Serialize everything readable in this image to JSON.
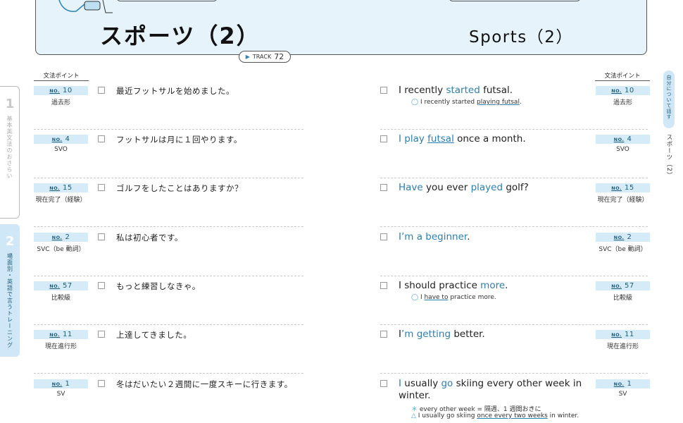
{
  "header": {
    "title_jp": "スポーツ（2）",
    "title_en": "Sports（2）",
    "track_label": "TRACK",
    "track_number": "72"
  },
  "grammar_header": "文法ポイント",
  "left_sidebar": {
    "section1_number": "1",
    "section1_label": "基本英文法のおさらい",
    "section2_number": "2",
    "section2_label": "場面別・英語で言うトレーニング"
  },
  "right_sidebar": {
    "tab_label": "自分について話す",
    "sub_label": "スポーツ（2）"
  },
  "no_label": "NO.",
  "rows": [
    {
      "no": "10",
      "grammar": "過去形",
      "jp": "最近フットサルを始めました。",
      "en": [
        {
          "t": "I recently "
        },
        {
          "t": "started",
          "hl": true
        },
        {
          "t": " futsal."
        }
      ],
      "notes": [
        {
          "mark": "◯",
          "parts": [
            {
              "t": "I recently started "
            },
            {
              "t": "playing futsal",
              "ul": true
            },
            {
              "t": "."
            }
          ]
        }
      ]
    },
    {
      "no": "4",
      "grammar": "SVO",
      "jp": "フットサルは月に１回やります。",
      "en": [
        {
          "t": "I play ",
          "hl": true
        },
        {
          "t": "futsal",
          "hl": true,
          "ul": true
        },
        {
          "t": " once a month."
        }
      ],
      "notes": []
    },
    {
      "no": "15",
      "grammar": "現在完了（経験）",
      "jp": "ゴルフをしたことはありますか？",
      "en": [
        {
          "t": "Have",
          "hl": true
        },
        {
          "t": " you ever "
        },
        {
          "t": "played",
          "hl": true
        },
        {
          "t": " golf?"
        }
      ],
      "notes": []
    },
    {
      "no": "2",
      "grammar": "SVC（be 動詞）",
      "jp": "私は初心者です。",
      "en": [
        {
          "t": "I’m a beginner",
          "hl": true
        },
        {
          "t": "."
        }
      ],
      "notes": []
    },
    {
      "no": "57",
      "grammar": "比較級",
      "jp": "もっと練習しなきゃ。",
      "en": [
        {
          "t": "I should practice "
        },
        {
          "t": "more",
          "hl": true
        },
        {
          "t": "."
        }
      ],
      "notes": [
        {
          "mark": "◯",
          "parts": [
            {
              "t": "I "
            },
            {
              "t": "have to",
              "ul": true
            },
            {
              "t": " practice more."
            }
          ]
        }
      ]
    },
    {
      "no": "11",
      "grammar": "現在進行形",
      "jp": "上達してきました。",
      "en": [
        {
          "t": "I"
        },
        {
          "t": "’m getting",
          "hl": true
        },
        {
          "t": " better."
        }
      ],
      "notes": []
    },
    {
      "no": "1",
      "grammar": "SV",
      "jp": "冬はだいたい２週間に一度スキーに行きます。",
      "en": [
        {
          "t": "I",
          "hl": true
        },
        {
          "t": " usually "
        },
        {
          "t": "go",
          "hl": true
        },
        {
          "t": " skiing every other week in winter."
        }
      ],
      "notes": [
        {
          "mark": "＊",
          "parts": [
            {
              "t": "every other week = 隔週、1 週間おきに"
            }
          ]
        },
        {
          "mark": "△",
          "parts": [
            {
              "t": "I usually go skiing "
            },
            {
              "t": "once every two weeks",
              "ul": true
            },
            {
              "t": " in winter."
            }
          ]
        }
      ]
    }
  ]
}
